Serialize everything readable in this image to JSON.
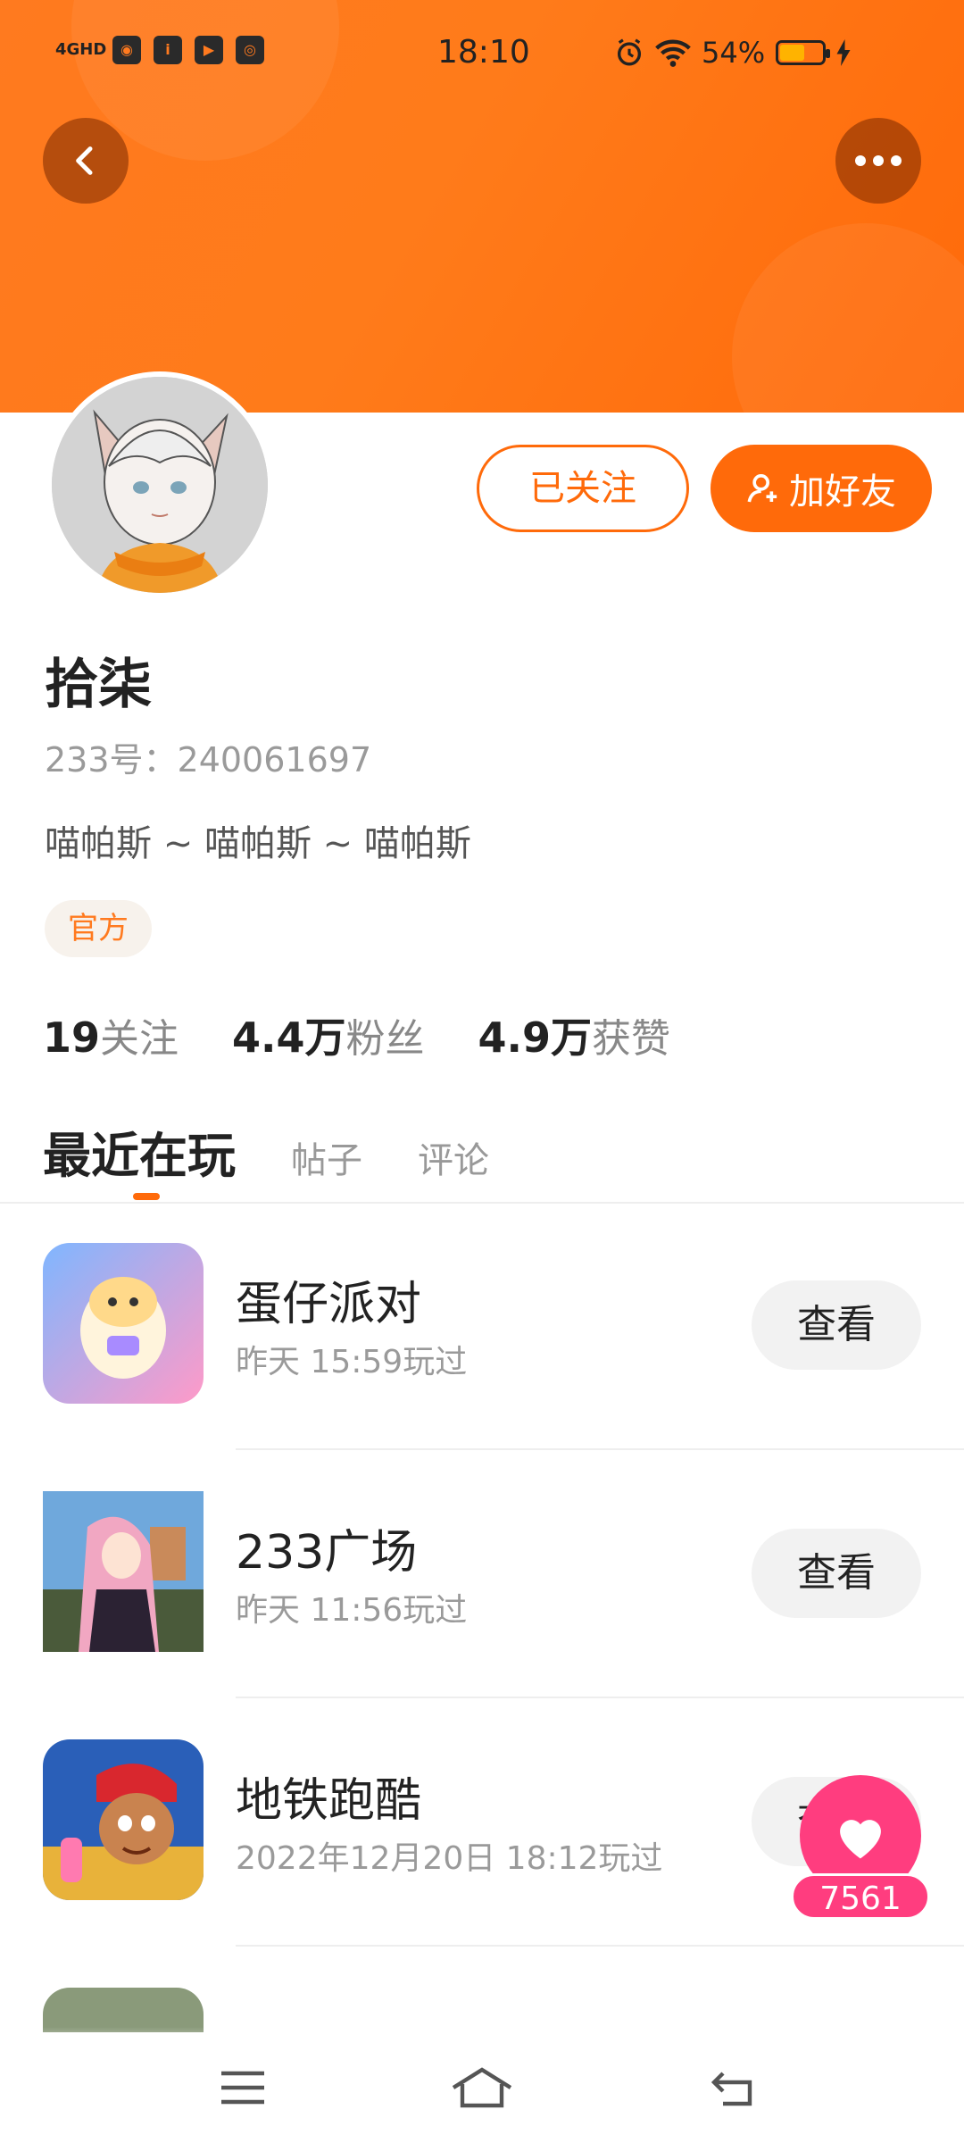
{
  "status_bar": {
    "network": "4GHD",
    "app_icons": [
      "gallery-app-icon",
      "iqiyi-app-icon",
      "video-app-icon",
      "browser-app-icon"
    ],
    "time": "18:10",
    "battery_percent": "54%",
    "battery_level": 0.54
  },
  "header": {
    "back_icon": "chevron-left-icon",
    "more_icon": "ellipsis-icon"
  },
  "profile": {
    "name": "拾柒",
    "uid": "233号：240061697",
    "bio": "喵帕斯 ~ 喵帕斯 ~ 喵帕斯",
    "tag": "官方",
    "follow_label": "已关注",
    "add_friend_label": "加好友",
    "stats": [
      {
        "num": "19",
        "label": "关注"
      },
      {
        "num": "4.4万",
        "label": "粉丝"
      },
      {
        "num": "4.9万",
        "label": "获赞"
      }
    ]
  },
  "tabs": {
    "active": "最近在玩",
    "items": [
      "帖子",
      "评论"
    ]
  },
  "games": [
    {
      "title": "蛋仔派对",
      "time": "昨天 15:59玩过",
      "action": "查看"
    },
    {
      "title": "233广场",
      "time": "昨天 11:56玩过",
      "action": "查看"
    },
    {
      "title": "地铁跑酷",
      "time": "2022年12月20日 18:12玩过",
      "action": "查看"
    }
  ],
  "like_badge": {
    "count": "7561"
  },
  "colors": {
    "accent": "#ff6a0a",
    "like": "#ff3d7f"
  }
}
